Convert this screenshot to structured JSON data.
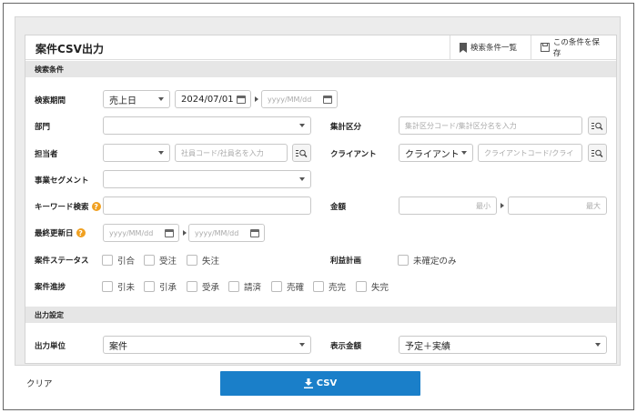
{
  "title": "案件CSV出力",
  "header_buttons": {
    "list": "検索条件一覧",
    "save": "この条件を保存"
  },
  "sections": {
    "search": "検索条件",
    "output": "出力設定"
  },
  "search_period": {
    "label": "検索期間",
    "type_value": "売上日",
    "from": "2024/07/01",
    "to_placeholder": "yyyy/MM/dd"
  },
  "department": {
    "label": "部門",
    "value": ""
  },
  "aggregate": {
    "label": "集計区分",
    "placeholder": "集計区分コード/集計区分名を入力"
  },
  "staff": {
    "label": "担当者",
    "value": "",
    "placeholder": "社員コード/社員名を入力"
  },
  "client": {
    "label": "クライアント",
    "type_value": "クライアント",
    "placeholder": "クライアントコード/クライ"
  },
  "segment": {
    "label": "事業セグメント",
    "value": ""
  },
  "keyword": {
    "label": "キーワード検索",
    "value": ""
  },
  "amount": {
    "label": "金額",
    "min_placeholder": "最小",
    "max_placeholder": "最大"
  },
  "updated": {
    "label": "最終更新日",
    "from_placeholder": "yyyy/MM/dd",
    "to_placeholder": "yyyy/MM/dd"
  },
  "case_status": {
    "label": "案件ステータス",
    "options": [
      "引合",
      "受注",
      "失注"
    ]
  },
  "profit_plan": {
    "label": "利益計画",
    "option": "未確定のみ"
  },
  "case_progress": {
    "label": "案件進捗",
    "options": [
      "引未",
      "引承",
      "受承",
      "請済",
      "売確",
      "売完",
      "失完"
    ]
  },
  "output_unit": {
    "label": "出力単位",
    "value": "案件"
  },
  "display_amount": {
    "label": "表示金額",
    "value": "予定＋実績"
  },
  "footer": {
    "clear": "クリア",
    "csv": "CSV"
  },
  "colors": {
    "primary": "#1a7fc9",
    "help": "#f0a020"
  }
}
